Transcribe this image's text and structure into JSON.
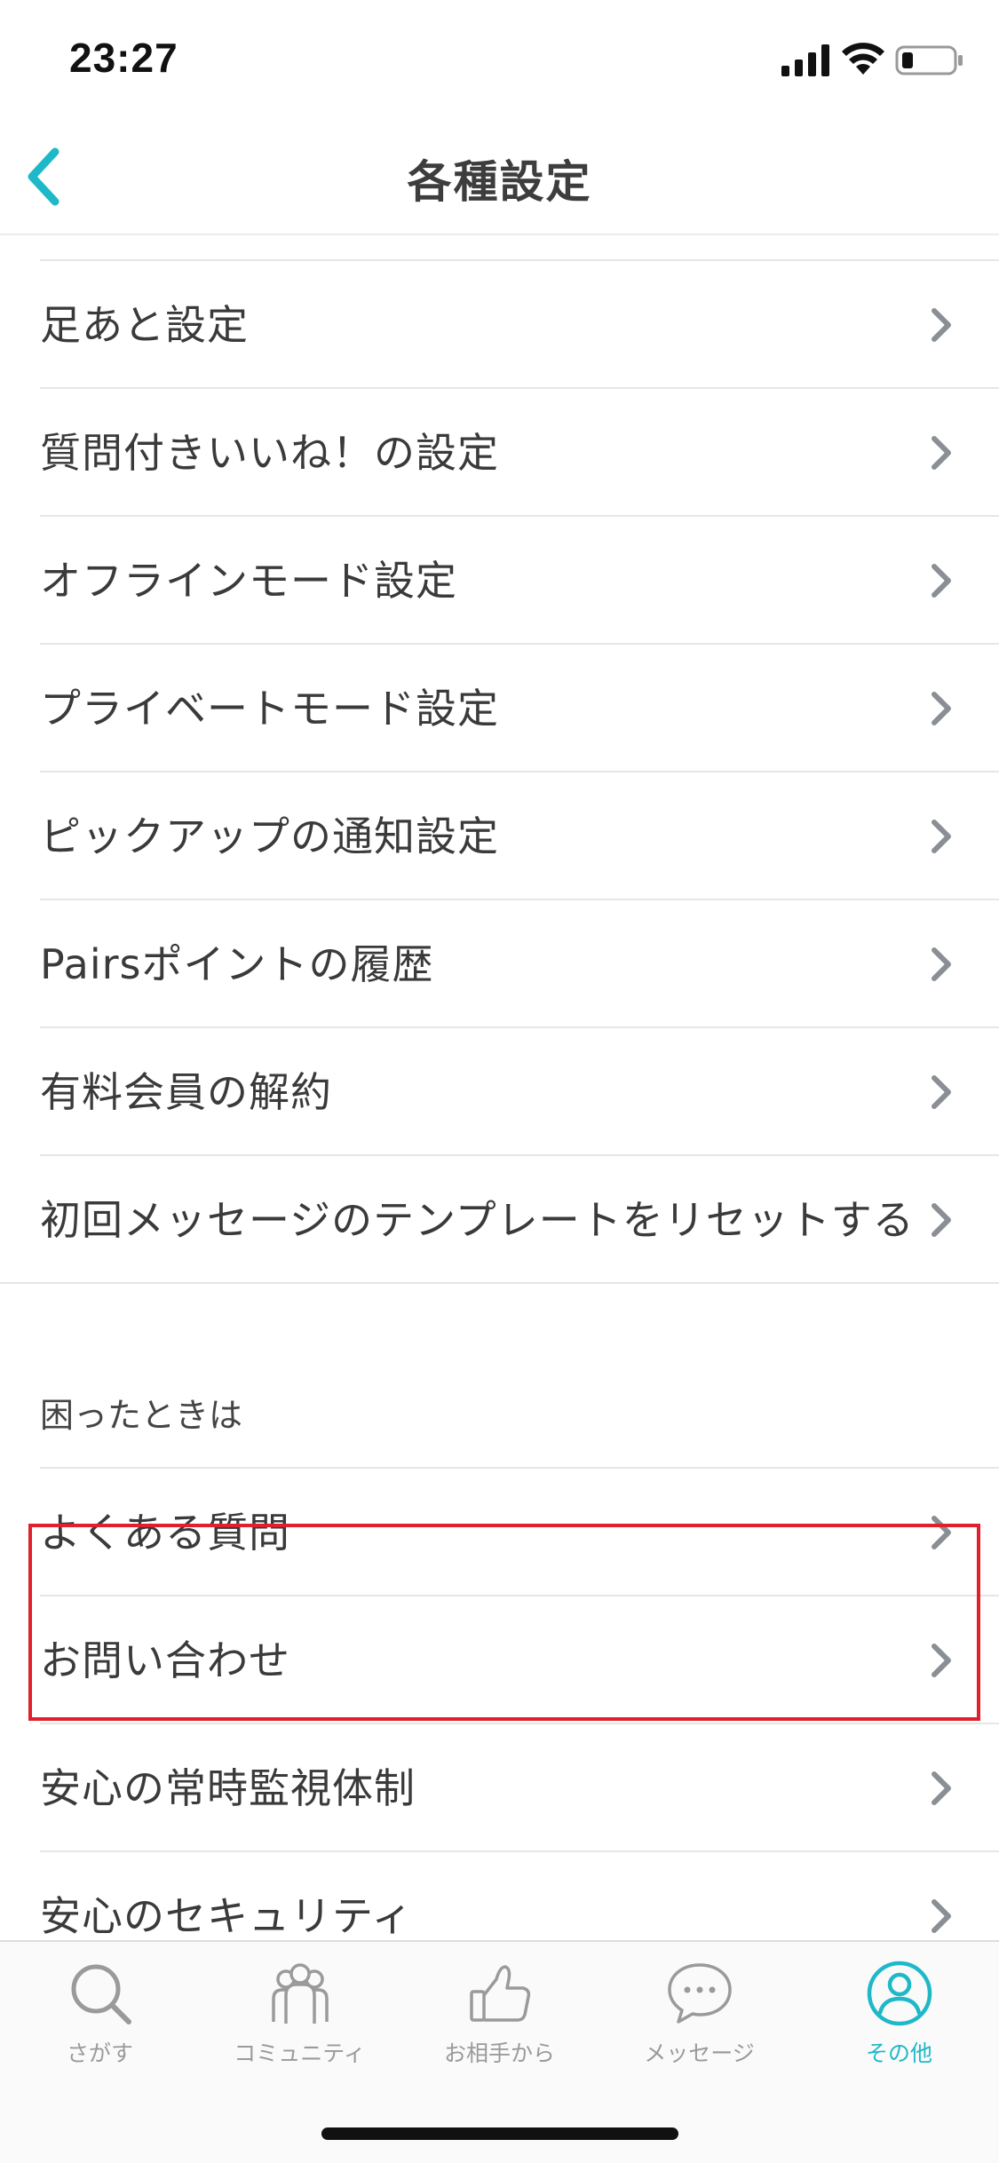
{
  "status_bar": {
    "time": "23:27"
  },
  "nav": {
    "title": "各種設定"
  },
  "settings_items": [
    {
      "label": "足あと設定"
    },
    {
      "label": "質問付きいいね！の設定"
    },
    {
      "label": "オフラインモード設定"
    },
    {
      "label": "プライベートモード設定"
    },
    {
      "label": "ピックアップの通知設定"
    },
    {
      "label": "Pairsポイントの履歴"
    },
    {
      "label": "有料会員の解約"
    },
    {
      "label": "初回メッセージのテンプレートをリセットする"
    }
  ],
  "help_section": {
    "header": "困ったときは",
    "items": [
      {
        "label": "よくある質問"
      },
      {
        "label": "お問い合わせ"
      },
      {
        "label": "安心の常時監視体制"
      },
      {
        "label": "安心のセキュリティ"
      }
    ]
  },
  "tabs": [
    {
      "label": "さがす",
      "icon": "search-icon"
    },
    {
      "label": "コミュニティ",
      "icon": "community-icon"
    },
    {
      "label": "お相手から",
      "icon": "thumbs-up-icon"
    },
    {
      "label": "メッセージ",
      "icon": "message-bubble-icon"
    },
    {
      "label": "その他",
      "icon": "profile-icon",
      "active": true
    }
  ],
  "colors": {
    "accent": "#1fb8c8",
    "highlight": "#e0202c",
    "chevron": "#8a8f96",
    "tab_inactive": "#9a9a9a"
  }
}
